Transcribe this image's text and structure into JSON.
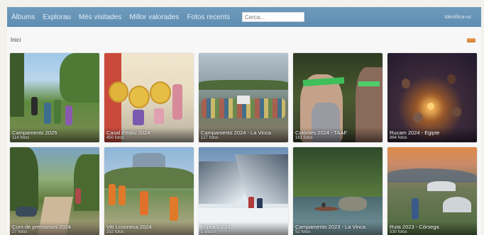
{
  "nav": {
    "items": [
      {
        "label": "Àlbums"
      },
      {
        "label": "Explorau"
      },
      {
        "label": "Més visitades"
      },
      {
        "label": "Millor valorades"
      },
      {
        "label": "Fotos recents"
      }
    ],
    "search_placeholder": "Cerca...",
    "login_label": "Identifica-us"
  },
  "breadcrumb": "Inici",
  "albums": [
    {
      "title": "Campaments 2025",
      "count": "114 fotos"
    },
    {
      "title": "Casal d'estiu 2024",
      "count": "450 fotos"
    },
    {
      "title": "Campaments 2024 - La Vinca",
      "count": "127 fotos"
    },
    {
      "title": "Colònies 2024 - TAAF",
      "count": "161 fotos"
    },
    {
      "title": "Rucam 2024 - Egipte",
      "count": "864 fotos"
    },
    {
      "title": "Curs de premonors 2024",
      "count": "27 fotos"
    },
    {
      "title": "Viti Lconneca 2024",
      "count": "252 fotos"
    },
    {
      "title": "Esplai 23-24",
      "count": "1 àlbum"
    },
    {
      "title": "Campaments 2023 - La Vinca",
      "count": "52 fotos"
    },
    {
      "title": "Ruta 2023 - Còrsega",
      "count": "530 fotos"
    }
  ],
  "colors": {
    "navbar": "#6593b6",
    "background": "#f7f7f7",
    "rss": "#e0913f"
  },
  "icons": {
    "feed": "rss-icon"
  }
}
